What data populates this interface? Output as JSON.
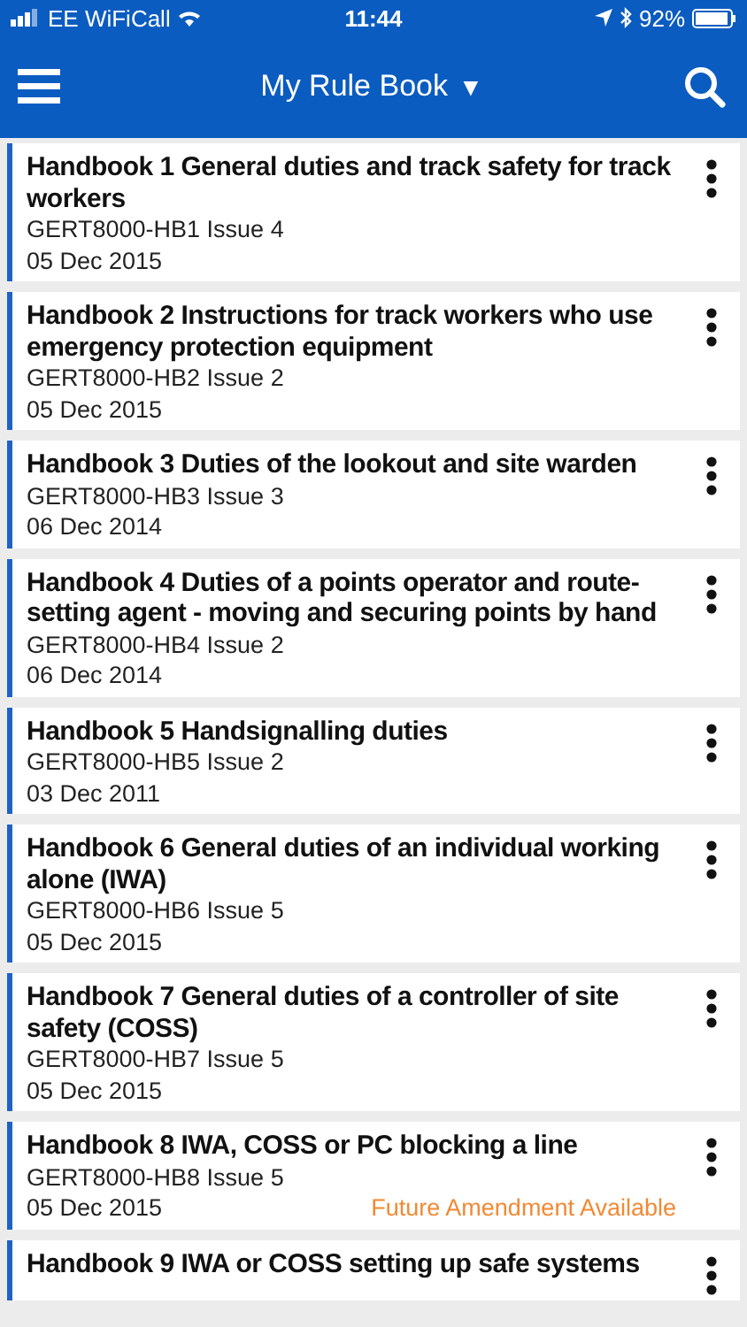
{
  "status_bar": {
    "carrier": "EE WiFiCall",
    "time": "11:44",
    "battery": "92%"
  },
  "header": {
    "title": "My Rule Book",
    "caret": "▼"
  },
  "handbooks": [
    {
      "title": "Handbook 1 General duties and track safety for track workers",
      "code": "GERT8000-HB1 Issue 4",
      "date": "05 Dec 2015"
    },
    {
      "title": "Handbook 2 Instructions for track workers who use emergency protection equipment",
      "code": "GERT8000-HB2 Issue 2",
      "date": "05 Dec 2015"
    },
    {
      "title": "Handbook 3 Duties of the lookout and site warden",
      "code": "GERT8000-HB3 Issue 3",
      "date": "06 Dec 2014"
    },
    {
      "title": "Handbook 4 Duties of a points operator and route-setting agent - moving and securing points by hand",
      "code": "GERT8000-HB4 Issue 2",
      "date": "06 Dec 2014"
    },
    {
      "title": "Handbook 5 Handsignalling duties",
      "code": "GERT8000-HB5 Issue 2",
      "date": "03 Dec 2011"
    },
    {
      "title": "Handbook 6 General duties of an individual working alone (IWA)",
      "code": "GERT8000-HB6 Issue 5",
      "date": "05 Dec 2015"
    },
    {
      "title": "Handbook 7 General duties of a controller of site safety (COSS)",
      "code": "GERT8000-HB7 Issue 5",
      "date": "05 Dec 2015"
    },
    {
      "title": "Handbook 8 IWA, COSS or PC blocking a line",
      "code": "GERT8000-HB8 Issue 5",
      "date": "05 Dec 2015",
      "notice": "Future Amendment Available"
    },
    {
      "title": "Handbook 9 IWA or COSS setting up safe systems"
    }
  ]
}
